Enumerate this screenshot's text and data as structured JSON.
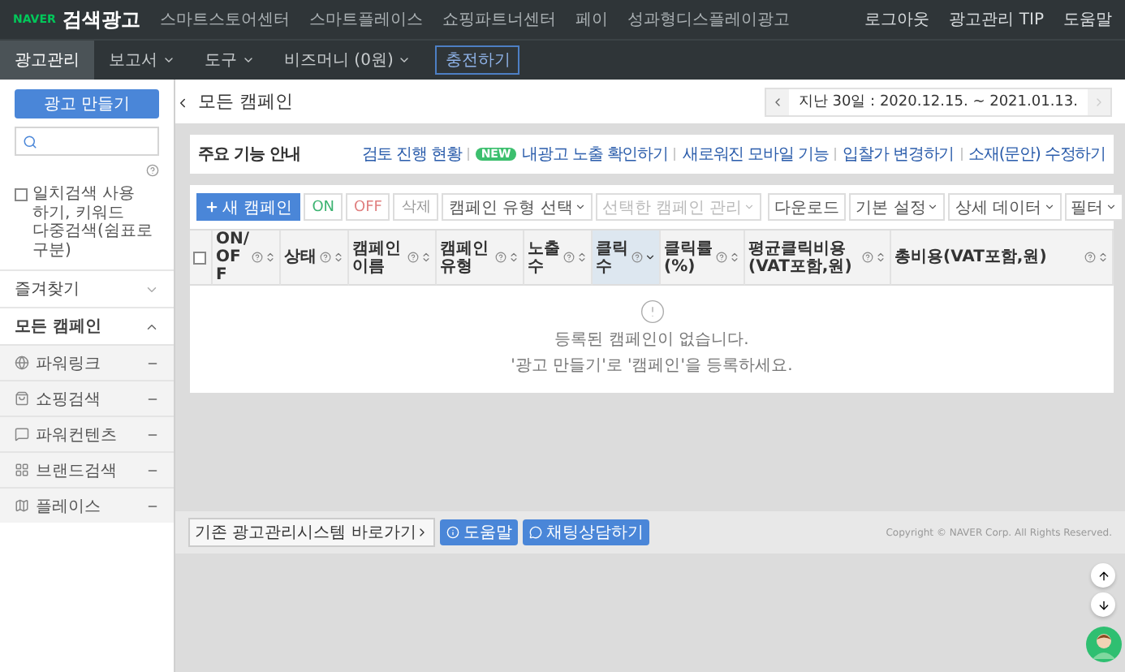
{
  "top_nav": {
    "brand": "NAVER",
    "title": "검색광고",
    "links": [
      "스마트스토어센터",
      "스마트플레이스",
      "쇼핑파트너센터",
      "페이",
      "성과형디스플레이광고"
    ],
    "right_links": [
      "로그아웃",
      "광고관리 TIP",
      "도움말"
    ]
  },
  "sub_nav": {
    "items": [
      {
        "label": "광고관리",
        "selected": true,
        "dropdown": false
      },
      {
        "label": "보고서",
        "selected": false,
        "dropdown": true
      },
      {
        "label": "도구",
        "selected": false,
        "dropdown": true
      },
      {
        "label": "비즈머니 (0원)",
        "selected": false,
        "dropdown": true
      }
    ],
    "charge_button": "충전하기"
  },
  "sidebar": {
    "create_button": "광고 만들기",
    "exact_match": {
      "checked": false,
      "label": "일치검색 사용 하기, 키워드 다중검색(쉼표로 구분)"
    },
    "sections": [
      {
        "label": "즐겨찾기",
        "expanded": false
      },
      {
        "label": "모든 캠페인",
        "expanded": true
      }
    ],
    "campaign_types": [
      "파워링크",
      "쇼핑검색",
      "파워컨텐츠",
      "브랜드검색",
      "플레이스"
    ]
  },
  "page_title": "모든 캠페인",
  "date_range": "지난 30일 : 2020.12.15. ~ 2021.01.13.",
  "guide": {
    "title": "주요 기능 안내",
    "links": [
      {
        "label": "검토 진행 현황"
      },
      {
        "label": "내광고 노출 확인하기",
        "badge": "NEW"
      },
      {
        "label": "새로워진 모바일 기능"
      },
      {
        "label": "입찰가 변경하기"
      },
      {
        "label": "소재(문안) 수정하기"
      }
    ]
  },
  "toolbar": {
    "new_button": "새 캠페인",
    "toggles": [
      {
        "label": "ON",
        "kind": "on"
      },
      {
        "label": "OFF",
        "kind": "off"
      },
      {
        "label": "삭제",
        "kind": "plain"
      }
    ],
    "dropdowns": [
      {
        "label": "캠페인 유형 선택",
        "disabled": false
      },
      {
        "label": "선택한 캠페인 관리",
        "disabled": true
      }
    ],
    "right": [
      {
        "label": "다운로드",
        "dropdown": false
      },
      {
        "label": "기본 설정",
        "dropdown": true
      },
      {
        "label": "상세 데이터",
        "dropdown": true
      },
      {
        "label": "필터",
        "dropdown": true
      }
    ]
  },
  "table": {
    "header_checkbox": {
      "checked": false
    },
    "columns": [
      {
        "label": "ON/OFF",
        "sorted": false
      },
      {
        "label": "상태",
        "sorted": false
      },
      {
        "label": "캠페인 이름",
        "sorted": false
      },
      {
        "label": "캠페인 유형",
        "sorted": false
      },
      {
        "label": "노출수",
        "sorted": false
      },
      {
        "label": "클릭수",
        "sorted": true
      },
      {
        "label": "클릭률(%)",
        "sorted": false
      },
      {
        "label": "평균클릭비용(VAT포함,원)",
        "sorted": false
      },
      {
        "label": "총비용(VAT포함,원)",
        "sorted": false
      }
    ],
    "empty_message": [
      "등록된 캠페인이 없습니다.",
      "'광고 만들기'로 '캠페인'을 등록하세요."
    ]
  },
  "footer": {
    "legacy_link": "기존 광고관리시스템 바로가기",
    "buttons": [
      "도움말",
      "채팅상담하기"
    ],
    "copyright": "Copyright © NAVER Corp. All Rights Reserved."
  }
}
